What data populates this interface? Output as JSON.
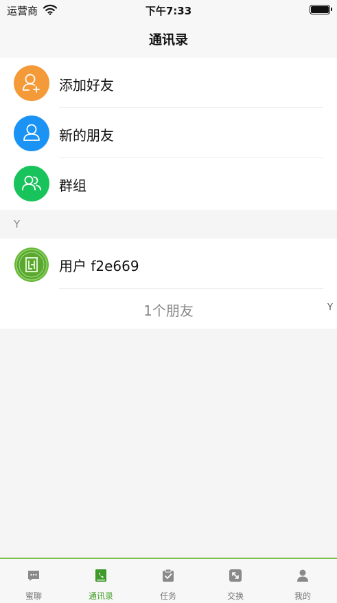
{
  "status_bar": {
    "carrier": "运营商",
    "time": "下午7:33"
  },
  "nav": {
    "title": "通讯录"
  },
  "actions": [
    {
      "label": "添加好友",
      "icon": "add-user-icon",
      "color": "#f59a38"
    },
    {
      "label": "新的朋友",
      "icon": "user-icon",
      "color": "#1a93f4"
    },
    {
      "label": "群组",
      "icon": "group-icon",
      "color": "#19c35b"
    }
  ],
  "section": {
    "letter": "Y"
  },
  "friends": [
    {
      "name": "用户 f2e669",
      "avatar_color": "#67b937"
    }
  ],
  "friend_count": "1个朋友",
  "index_bar": {
    "letter": "Y"
  },
  "tabs": [
    {
      "label": "蜜聊",
      "icon": "chat-icon",
      "active": false
    },
    {
      "label": "通讯录",
      "icon": "contacts-icon",
      "active": true
    },
    {
      "label": "任务",
      "icon": "task-icon",
      "active": false
    },
    {
      "label": "交换",
      "icon": "exchange-icon",
      "active": false
    },
    {
      "label": "我的",
      "icon": "profile-icon",
      "active": false
    }
  ],
  "colors": {
    "accent": "#4aa331",
    "tab_border": "#7cbf4e"
  }
}
